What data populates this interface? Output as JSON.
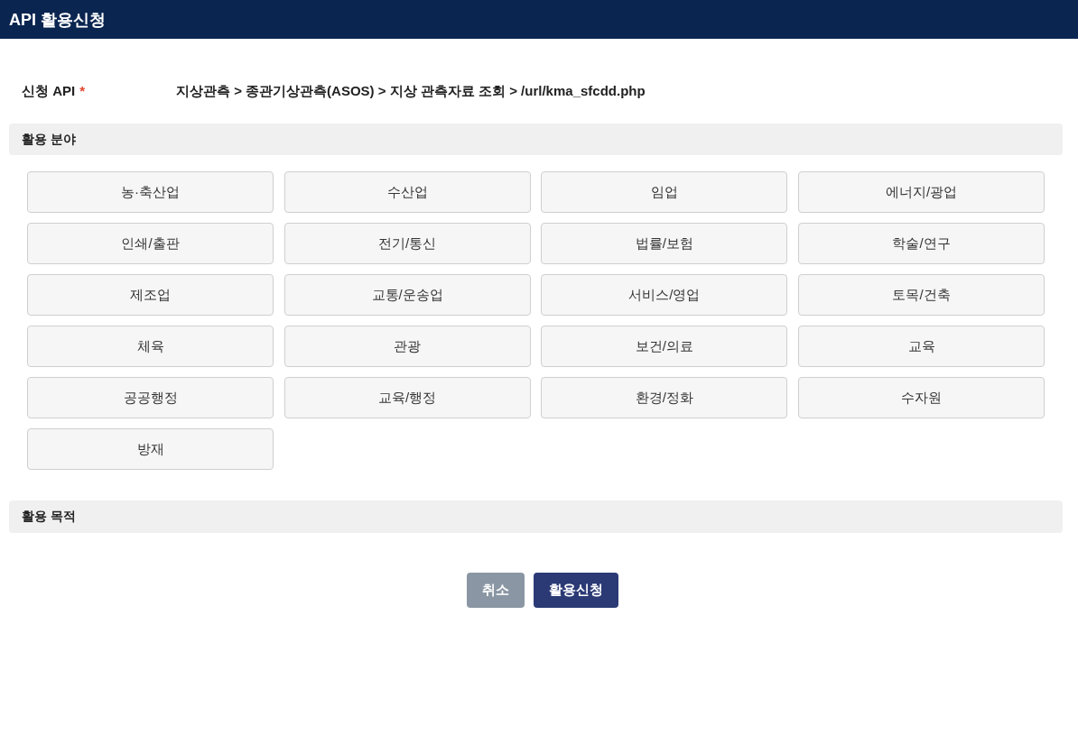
{
  "header": {
    "title": "API 활용신청"
  },
  "api_request": {
    "label": "신청 API",
    "required_mark": "*",
    "value": "지상관측 > 종관기상관측(ASOS) > 지상 관측자료 조회 > /url/kma_sfcdd.php"
  },
  "usage_field": {
    "title": "활용 분야",
    "options": [
      {
        "label": "농·축산업",
        "selected": false
      },
      {
        "label": "수산업",
        "selected": false
      },
      {
        "label": "임업",
        "selected": false
      },
      {
        "label": "에너지/광업",
        "selected": false
      },
      {
        "label": "인쇄/출판",
        "selected": false
      },
      {
        "label": "전기/통신",
        "selected": false
      },
      {
        "label": "법률/보험",
        "selected": false
      },
      {
        "label": "학술/연구",
        "selected": false
      },
      {
        "label": "제조업",
        "selected": false
      },
      {
        "label": "교통/운송업",
        "selected": false
      },
      {
        "label": "서비스/영업",
        "selected": false
      },
      {
        "label": "토목/건축",
        "selected": false
      },
      {
        "label": "체육",
        "selected": false
      },
      {
        "label": "관광",
        "selected": false
      },
      {
        "label": "보건/의료",
        "selected": false
      },
      {
        "label": "교육",
        "selected": false
      },
      {
        "label": "공공행정",
        "selected": false
      },
      {
        "label": "교육/행정",
        "selected": false
      },
      {
        "label": "환경/정화",
        "selected": false
      },
      {
        "label": "수자원",
        "selected": false
      },
      {
        "label": "방재",
        "selected": false
      }
    ]
  },
  "usage_purpose": {
    "title": "활용 목적"
  },
  "buttons": [
    {
      "label": "취소",
      "kind": "cancel"
    },
    {
      "label": "활용신청",
      "kind": "submit"
    }
  ]
}
